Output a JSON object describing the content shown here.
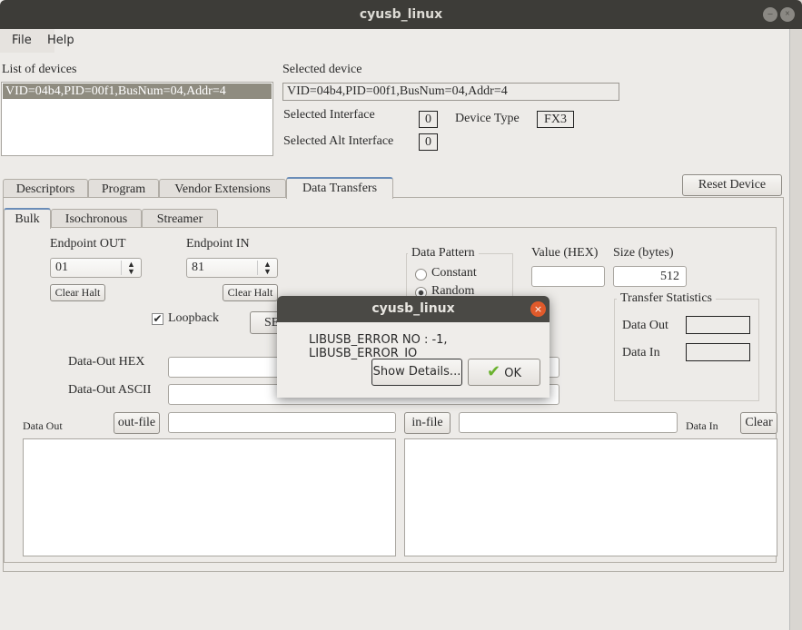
{
  "window": {
    "title": "cyusb_linux",
    "minimize_icon": "minimize-icon",
    "close_icon": "close-icon"
  },
  "menu": {
    "file": "File",
    "help": "Help"
  },
  "devices": {
    "label": "List of devices",
    "items": [
      "VID=04b4,PID=00f1,BusNum=04,Addr=4"
    ]
  },
  "selected": {
    "label": "Selected device",
    "value": "VID=04b4,PID=00f1,BusNum=04,Addr=4",
    "interface_label": "Selected Interface",
    "interface_value": "0",
    "alt_label": "Selected Alt Interface",
    "alt_value": "0",
    "type_label": "Device Type",
    "type_value": "FX3"
  },
  "tabs": [
    "Descriptors",
    "Program",
    "Vendor Extensions",
    "Data Transfers"
  ],
  "active_tab": "Data Transfers",
  "reset_button": "Reset Device",
  "subtabs": [
    "Bulk",
    "Isochronous",
    "Streamer"
  ],
  "active_subtab": "Bulk",
  "bulk": {
    "ep_out_label": "Endpoint OUT",
    "ep_out_value": "01",
    "ep_in_label": "Endpoint IN",
    "ep_in_value": "81",
    "clear_halt": "Clear Halt",
    "loopback_label": "Loopback",
    "loopback_checked": true,
    "send_button_visible": "SE",
    "pattern_title": "Data Pattern",
    "pattern_options": [
      "Constant",
      "Random"
    ],
    "pattern_selected": "Random",
    "value_label": "Value (HEX)",
    "value": "",
    "size_label": "Size (bytes)",
    "size_value": "512",
    "stats_title": "Transfer Statistics",
    "stats_out_label": "Data Out",
    "stats_in_label": "Data In",
    "hex_label": "Data-Out HEX",
    "ascii_label": "Data-Out ASCII",
    "data_out_label": "Data Out",
    "out_file": "out-file",
    "in_file": "in-file",
    "data_in_label": "Data In",
    "clear": "Clear"
  },
  "dialog": {
    "title": "cyusb_linux",
    "message": "LIBUSB_ERROR NO : -1, LIBUSB_ERROR_IO",
    "details_button": "Show Details...",
    "ok_button": "OK",
    "ok_icon": "checkmark-icon",
    "close_icon": "close-icon"
  },
  "colors": {
    "titlebar": "#3d3c38",
    "selection": "#8f8c80",
    "dialog_close": "#e05a2b"
  }
}
